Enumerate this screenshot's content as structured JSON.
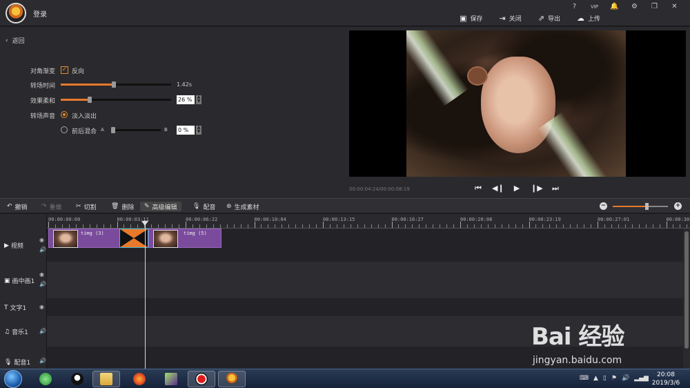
{
  "app": {
    "login": "登录",
    "window_controls": [
      "?",
      "VIP",
      "🔔",
      "⚙",
      "❐",
      "✕"
    ]
  },
  "top_actions": [
    {
      "label": "保存",
      "icon": "save-icon"
    },
    {
      "label": "关闭",
      "icon": "close-project-icon"
    },
    {
      "label": "导出",
      "icon": "export-icon"
    },
    {
      "label": "上传",
      "icon": "upload-icon"
    }
  ],
  "left_panel": {
    "back_label": "返回",
    "diagonal_gradient": {
      "label": "对角渐变",
      "checkbox_label": "反向",
      "checked": true
    },
    "transition_time": {
      "label": "转场时间",
      "value": "1.42s",
      "fraction": 0.48
    },
    "softness": {
      "label": "效果柔和",
      "value": "26 %",
      "fraction": 0.26
    },
    "transition_audio": {
      "label": "转场声音",
      "option1": "淡入淡出",
      "option2": "前后混合",
      "mix_a": "A",
      "mix_b": "B",
      "mix_value": "0 %",
      "mix_fraction": 0.0
    }
  },
  "preview": {
    "timecode": "00:00:04:24/00:00:08:19"
  },
  "toolbar": {
    "undo": "撤销",
    "redo": "重做",
    "cut": "切割",
    "delete": "删除",
    "advanced_edit": "高级编辑",
    "dub": "配音",
    "generate": "生成素材",
    "zoom_fraction": 0.62
  },
  "ruler": {
    "ticks": [
      "00:00:00:00",
      "00:00:03:11",
      "00:00:06:22",
      "00:00:10:04",
      "00:00:13:15",
      "00:00:16:27",
      "00:00:20:08",
      "00:00:23:19",
      "00:00:27:01",
      "00:00:30:1"
    ]
  },
  "tracks": [
    {
      "name": "视频",
      "icon": "play-track-icon",
      "eye": true,
      "speaker": true
    },
    {
      "name": "画中画1",
      "icon": "pip-track-icon",
      "eye": true,
      "speaker": true
    },
    {
      "name": "文字1",
      "icon": "text-track-icon",
      "eye": true,
      "speaker": false
    },
    {
      "name": "音乐1",
      "icon": "music-track-icon",
      "eye": false,
      "speaker": true
    },
    {
      "name": "配音1",
      "icon": "mic-track-icon",
      "eye": false,
      "speaker": true
    }
  ],
  "clips": [
    {
      "name": "timg (3)"
    },
    {
      "name": "timg (5)"
    }
  ],
  "taskbar": {
    "time": "20:08",
    "date": "2019/3/6"
  },
  "watermark": {
    "main": "Bai 经验",
    "sub": "jingyan.baidu.com"
  },
  "colors": {
    "accent": "#e8792a",
    "clip": "#7a4a9c",
    "background": "#1e1e22"
  }
}
